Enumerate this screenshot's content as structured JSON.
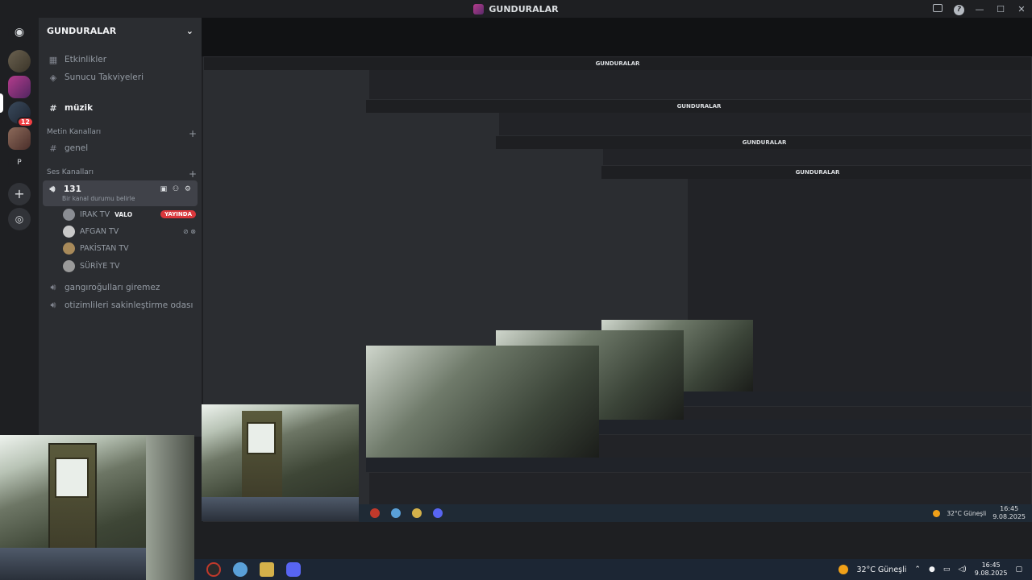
{
  "window": {
    "title": "GUNDURALAR"
  },
  "server": {
    "name": "GUNDURALAR"
  },
  "sidebar": {
    "top_items": [
      {
        "label": "Etkinlikler"
      },
      {
        "label": "Sunucu Takviyeleri"
      }
    ],
    "selected_channel": "müzik",
    "text_category": "Metin Kanalları",
    "text_channels": [
      {
        "label": "genel"
      }
    ],
    "voice_category": "Ses Kanalları",
    "voice_channel": {
      "name": "131",
      "status": "Bir kanal durumu belirle"
    },
    "members": [
      {
        "name": "IRAK TV",
        "activity": "VALO",
        "badge": "YAYINDA"
      },
      {
        "name": "AFGAN TV"
      },
      {
        "name": "PAKİSTAN TV"
      },
      {
        "name": "SÜRİYE TV"
      }
    ],
    "other_voice": [
      {
        "label": "gangıroğulları giremez"
      },
      {
        "label": "otizimlileri sakinleştirme odası"
      }
    ]
  },
  "guilds": {
    "badge_count": "12",
    "letter": "P"
  },
  "taskbar": {
    "weather": "32°C  Güneşli",
    "time": "16:45",
    "date": "9.08.2025"
  },
  "icons": {
    "discord": "discord-logo-icon",
    "hash": "hash-icon",
    "speaker": "speaker-icon",
    "add": "plus-icon",
    "explore": "compass-icon",
    "chevron": "chevron-down-icon"
  },
  "colors": {
    "live_badge": "#da373c",
    "accent": "#5865f2",
    "badge": "#f23f43"
  }
}
